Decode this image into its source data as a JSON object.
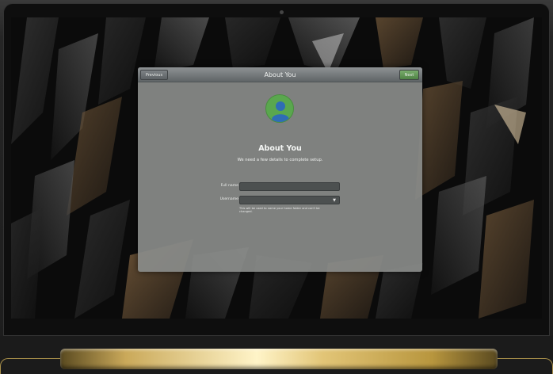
{
  "dialog": {
    "title": "About You",
    "previous_label": "Previous",
    "next_label": "Next",
    "heading": "About You",
    "subtitle": "We need a few details to complete setup.",
    "full_name_label": "Full name",
    "full_name_value": "",
    "username_label": "Username",
    "username_value": "",
    "username_hint": "This will be used to name your home folder and can't be changed."
  },
  "icons": {
    "avatar": "user-avatar-icon",
    "dropdown": "chevron-down-icon"
  },
  "colors": {
    "next_button": "#5e9453",
    "avatar_bg": "#5aa74e",
    "avatar_figure": "#2f6db5",
    "dialog_bg": "#8a8c8a",
    "gold": "#caa95a"
  }
}
